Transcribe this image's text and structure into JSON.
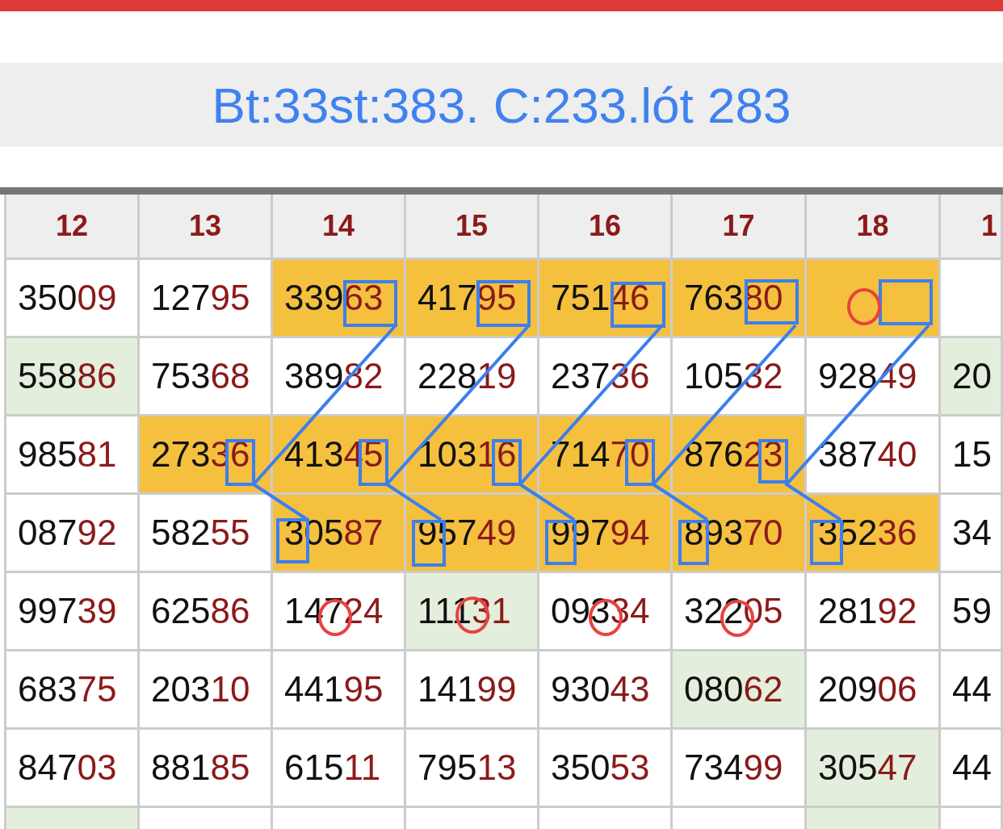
{
  "banner": {
    "title": "Bt:33st:383. C:233.lót 283"
  },
  "table": {
    "columns": [
      "12",
      "13",
      "14",
      "15",
      "16",
      "17",
      "18",
      "1"
    ],
    "rows": [
      {
        "cells": [
          {
            "head": "350",
            "tail": "09"
          },
          {
            "head": "127",
            "tail": "95"
          },
          {
            "head": "339",
            "tail": "63",
            "color": "#f4c03e"
          },
          {
            "head": "417",
            "tail": "95",
            "color": "#f4c03e"
          },
          {
            "head": "751",
            "tail": "46",
            "color": "#f4c03e"
          },
          {
            "head": "763",
            "tail": "80",
            "color": "#f4c03e"
          },
          {
            "color": "#f4c03e"
          },
          {}
        ]
      },
      {
        "cells": [
          {
            "head": "558",
            "tail": "86",
            "color": "#e3efdc"
          },
          {
            "head": "753",
            "tail": "68"
          },
          {
            "head": "389",
            "tail": "82"
          },
          {
            "head": "228",
            "tail": "19"
          },
          {
            "head": "237",
            "tail": "36"
          },
          {
            "head": "105",
            "tail": "32"
          },
          {
            "head": "928",
            "tail": "49"
          },
          {
            "head": "20",
            "color": "#e3efdc"
          }
        ]
      },
      {
        "cells": [
          {
            "head": "985",
            "tail": "81"
          },
          {
            "head": "273",
            "tail": "36",
            "color": "#f4c03e"
          },
          {
            "head": "413",
            "tail": "45",
            "color": "#f4c03e"
          },
          {
            "head": "103",
            "tail": "16",
            "color": "#f4c03e"
          },
          {
            "head": "714",
            "tail": "70",
            "color": "#f4c03e"
          },
          {
            "head": "876",
            "tail": "23",
            "color": "#f4c03e"
          },
          {
            "head": "387",
            "tail": "40"
          },
          {
            "head": "15"
          }
        ]
      },
      {
        "cells": [
          {
            "head": "087",
            "tail": "92"
          },
          {
            "head": "582",
            "tail": "55"
          },
          {
            "head": "305",
            "tail": "87",
            "color": "#f4c03e"
          },
          {
            "head": "957",
            "tail": "49",
            "color": "#f4c03e"
          },
          {
            "head": "997",
            "tail": "94",
            "color": "#f4c03e"
          },
          {
            "head": "893",
            "tail": "70",
            "color": "#f4c03e"
          },
          {
            "head": "352",
            "tail": "36",
            "color": "#f4c03e"
          },
          {
            "head": "34"
          }
        ]
      },
      {
        "cells": [
          {
            "head": "997",
            "tail": "39"
          },
          {
            "head": "625",
            "tail": "86"
          },
          {
            "head": "147",
            "tail": "24"
          },
          {
            "head": "111",
            "tail": "31",
            "color": "#e3efdc"
          },
          {
            "head": "093",
            "tail": "34"
          },
          {
            "head": "322",
            "tail": "05"
          },
          {
            "head": "281",
            "tail": "92"
          },
          {
            "head": "59"
          }
        ]
      },
      {
        "cells": [
          {
            "head": "683",
            "tail": "75"
          },
          {
            "head": "203",
            "tail": "10"
          },
          {
            "head": "441",
            "tail": "95"
          },
          {
            "head": "141",
            "tail": "99"
          },
          {
            "head": "930",
            "tail": "43"
          },
          {
            "head": "080",
            "tail": "62",
            "color": "#e3efdc"
          },
          {
            "head": "209",
            "tail": "06"
          },
          {
            "head": "44"
          }
        ]
      },
      {
        "cells": [
          {
            "head": "847",
            "tail": "03"
          },
          {
            "head": "881",
            "tail": "85"
          },
          {
            "head": "615",
            "tail": "11"
          },
          {
            "head": "795",
            "tail": "13"
          },
          {
            "head": "350",
            "tail": "53"
          },
          {
            "head": "734",
            "tail": "99"
          },
          {
            "head": "305",
            "tail": "47",
            "color": "#e3efdc"
          },
          {
            "head": "44"
          }
        ]
      },
      {
        "cells": [
          {
            "color": "#e3efdc"
          },
          {},
          {},
          {},
          {},
          {},
          {
            "color": "#e3efdc"
          },
          {}
        ]
      }
    ]
  }
}
